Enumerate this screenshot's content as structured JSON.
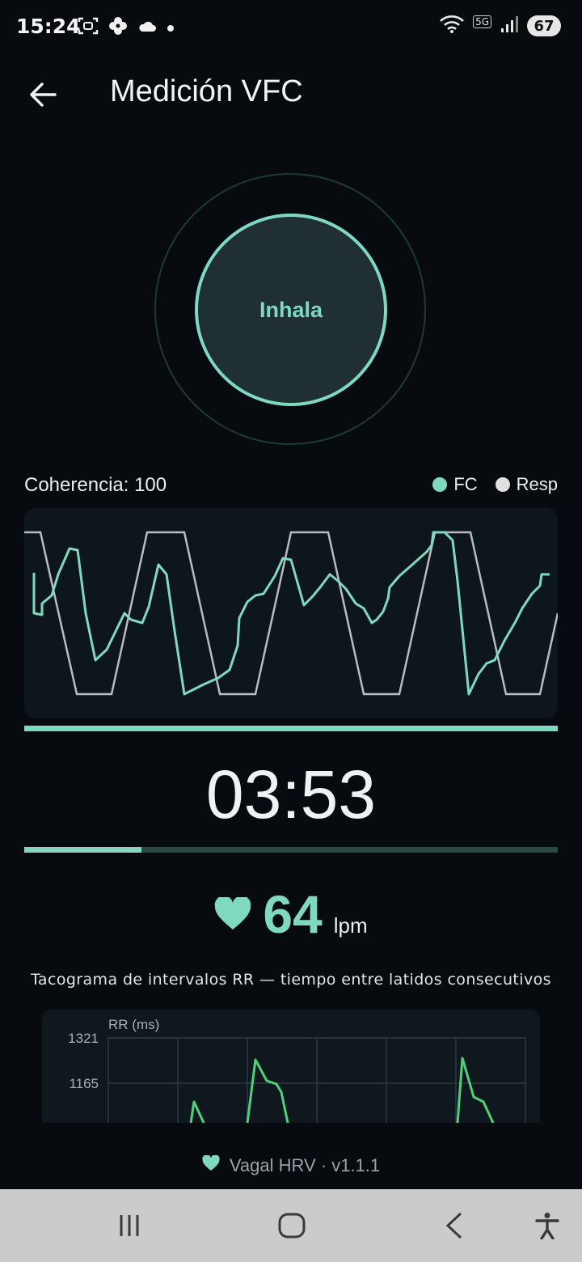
{
  "status_bar": {
    "time": "15:24",
    "network": "5G",
    "battery": "67",
    "left_icons": [
      "screenshot-icon",
      "pinwheel-icon",
      "cloud-icon",
      "dot-icon"
    ],
    "right_icons": [
      "wifi-icon",
      "signal-icon",
      "battery-icon"
    ]
  },
  "header": {
    "title": "Medición VFC"
  },
  "breathing": {
    "phase_label": "Inhala"
  },
  "coherence": {
    "label": "Coherencia: 100"
  },
  "legend": {
    "fc_label": "FC",
    "resp_label": "Resp",
    "fc_color": "#7fd9c1",
    "resp_color": "#e0e0e0"
  },
  "timer": {
    "value": "03:53",
    "progress_fraction": 0.22
  },
  "heart_rate": {
    "value": "64",
    "unit": "lpm"
  },
  "tachogram": {
    "title": "Tacograma de intervalos RR — tiempo entre latidos consecutivos",
    "ylabel": "RR (ms)",
    "ticks": [
      "1321",
      "1165"
    ]
  },
  "footer": {
    "label": "Vagal HRV · v1.1.1"
  },
  "colors": {
    "accent": "#7fd9c1",
    "background": "#070b10"
  }
}
